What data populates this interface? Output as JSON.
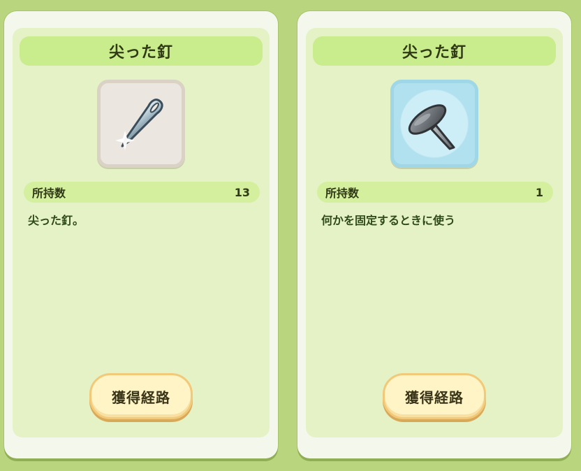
{
  "panels": [
    {
      "title": "尖った釘",
      "icon": "needle-icon",
      "count_label": "所持数",
      "count_value": "13",
      "description": "尖った釘。",
      "button_label": "獲得経路"
    },
    {
      "title": "尖った釘",
      "icon": "nail-icon",
      "count_label": "所持数",
      "count_value": "1",
      "description": "何かを固定するときに使う",
      "button_label": "獲得経路"
    }
  ],
  "colors": {
    "background": "#b9d67e",
    "title_bar": "#c9ec8c",
    "count_bar": "#d4ef9e",
    "button_fill": "#fff4c6",
    "button_border": "#f2c978"
  }
}
